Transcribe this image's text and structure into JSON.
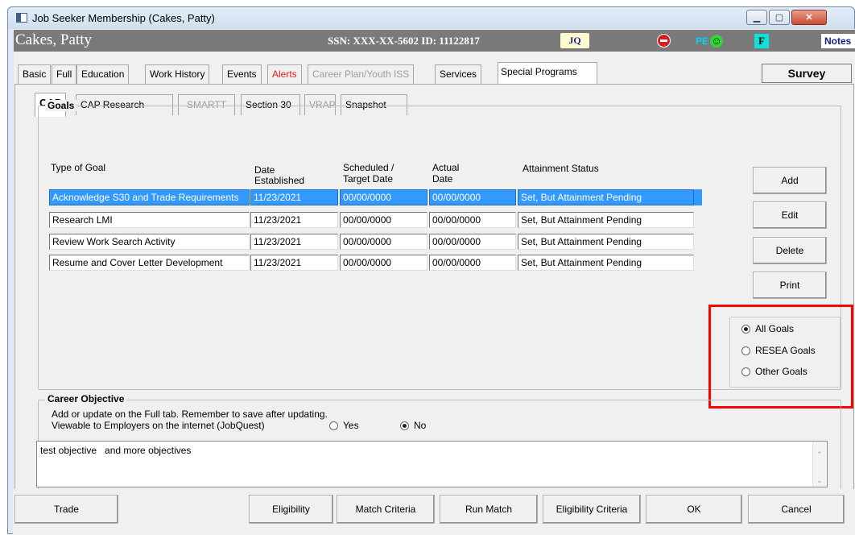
{
  "window": {
    "title": "Job Seeker Membership (Cakes, Patty)"
  },
  "header": {
    "name": "Cakes, Patty",
    "ssn_line": "SSN:  XXX-XX-5602 ID: 11122817",
    "jq_label": "JQ",
    "pe_label": "PE",
    "f_label": "F",
    "notes_label": "Notes"
  },
  "tabs": [
    {
      "label": "Basic"
    },
    {
      "label": "Full"
    },
    {
      "label": "Education"
    },
    {
      "label": "Work History"
    },
    {
      "label": "Events"
    },
    {
      "label": "Alerts"
    },
    {
      "label": "Career Plan/Youth ISS"
    },
    {
      "label": "Services"
    },
    {
      "label": "Special Programs"
    }
  ],
  "survey_label": "Survey",
  "subtabs": [
    {
      "label": "CAP"
    },
    {
      "label": "CAP Research"
    },
    {
      "label": "SMARTT"
    },
    {
      "label": "Section 30"
    },
    {
      "label": "VRAP"
    },
    {
      "label": "Snapshot"
    }
  ],
  "goals": {
    "group_label": "Goals",
    "headers": {
      "type": "Type of Goal",
      "established_1": "Date",
      "established_2": "Established",
      "target_1": "Scheduled /",
      "target_2": "Target Date",
      "actual_1": "Actual",
      "actual_2": "Date",
      "status": "Attainment Status"
    },
    "rows": [
      {
        "type": "Acknowledge S30 and Trade Requirements",
        "established": "11/23/2021",
        "target": "00/00/0000",
        "actual": "00/00/0000",
        "status": "Set, But Attainment Pending"
      },
      {
        "type": "Research LMI",
        "established": "11/23/2021",
        "target": "00/00/0000",
        "actual": "00/00/0000",
        "status": "Set, But Attainment Pending"
      },
      {
        "type": "Review Work Search Activity",
        "established": "11/23/2021",
        "target": "00/00/0000",
        "actual": "00/00/0000",
        "status": "Set, But Attainment Pending"
      },
      {
        "type": "Resume and Cover Letter Development",
        "established": "11/23/2021",
        "target": "00/00/0000",
        "actual": "00/00/0000",
        "status": "Set, But Attainment Pending"
      }
    ],
    "buttons": {
      "add": "Add",
      "edit": "Edit",
      "delete": "Delete",
      "print": "Print"
    },
    "filter": {
      "options": [
        "All Goals",
        "RESEA Goals",
        "Other Goals"
      ],
      "selected": "All Goals"
    }
  },
  "career": {
    "group_label": "Career Objective",
    "note": "Add or update on the Full tab.  Remember to save after updating.",
    "viewable_label": "Viewable to Employers on the internet (JobQuest)",
    "yes_label": "Yes",
    "no_label": "No",
    "selected": "No",
    "objective_text": "test objective   and more objectives"
  },
  "bottom_buttons": {
    "trade": "Trade",
    "eligibility": "Eligibility",
    "match_criteria": "Match Criteria",
    "run_match": "Run Match",
    "eligibility_criteria": "Eligibility Criteria",
    "ok": "OK",
    "cancel": "Cancel"
  },
  "colors": {
    "selection": "#3399ff",
    "alerts_tab": "#e21b1b",
    "highlight_box": "#ff0000",
    "header_bar": "#7a7a7a"
  }
}
